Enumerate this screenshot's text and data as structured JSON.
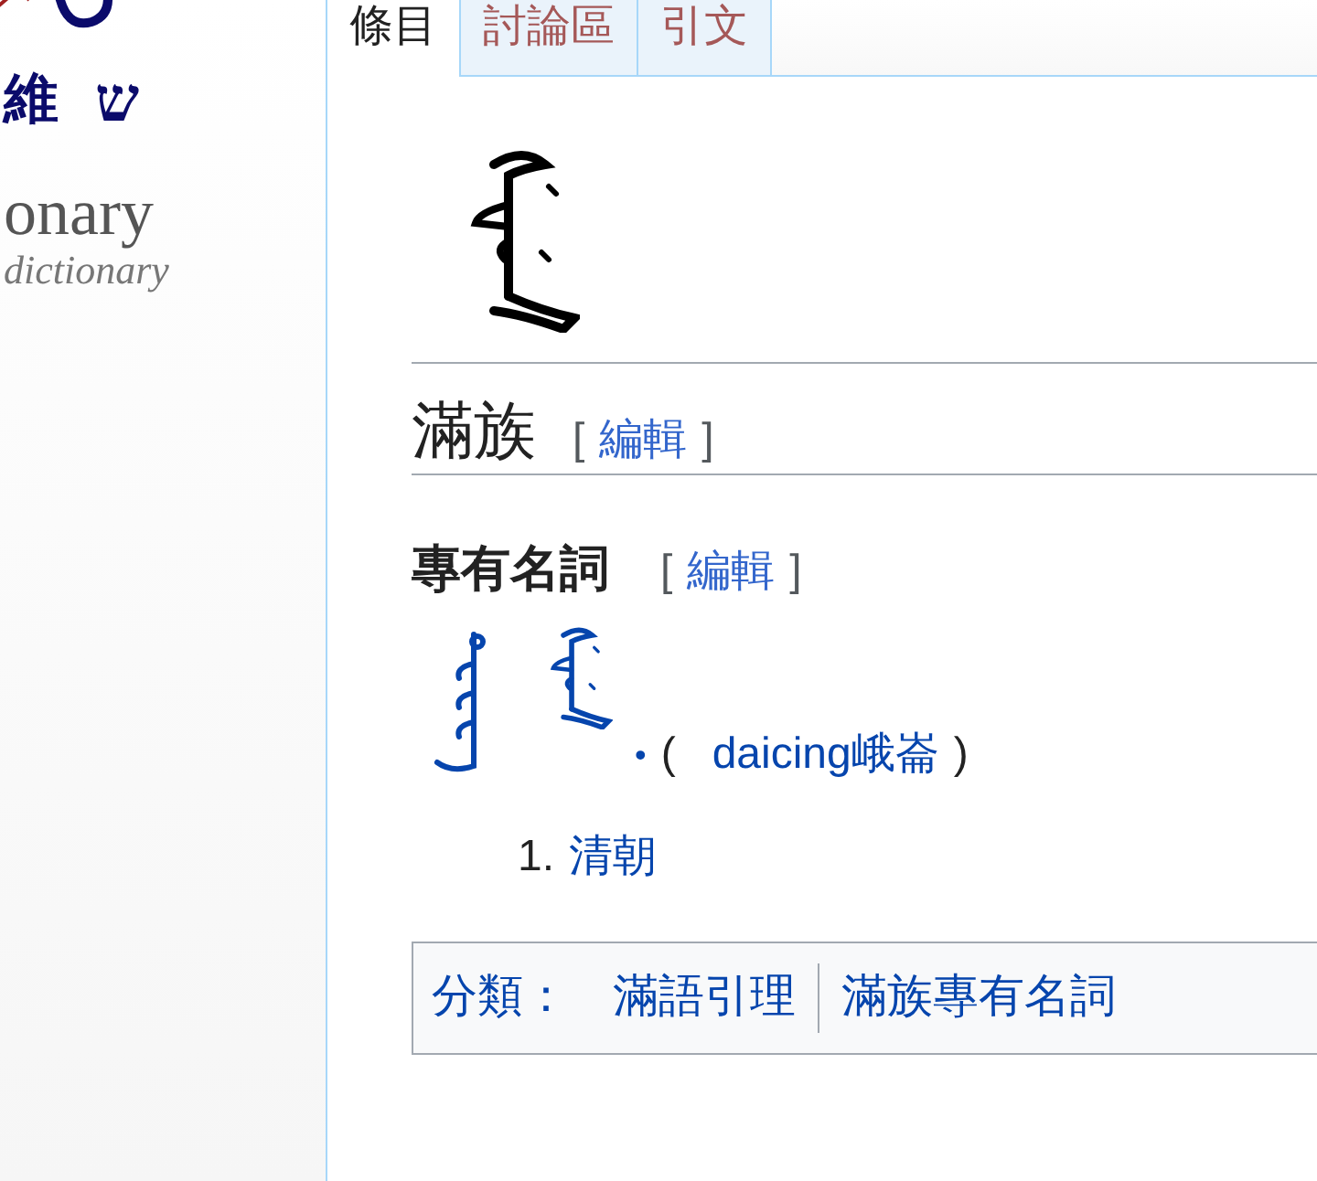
{
  "logo": {
    "glyph_1": "維",
    "glyph_2": "ש",
    "name": "onary",
    "tagline": "dictionary"
  },
  "tabs": [
    {
      "label": "條目",
      "selected": true
    },
    {
      "label": "討論區",
      "selected": false
    },
    {
      "label": "引文",
      "selected": false
    }
  ],
  "heading": {
    "title": "滿族",
    "open": "[",
    "edit": "編輯",
    "close": "]"
  },
  "section": {
    "title": "專有名詞",
    "open": "[",
    "edit": "編輯",
    "close": "]"
  },
  "headword": {
    "bullet": "•",
    "open": "(",
    "link": "daicing峨崙",
    "close": ")"
  },
  "definitions": [
    {
      "number": "1.",
      "text": "清朝"
    }
  ],
  "categories": {
    "label": "分類：",
    "items": [
      "滿語引理",
      "滿族專有名詞"
    ]
  }
}
